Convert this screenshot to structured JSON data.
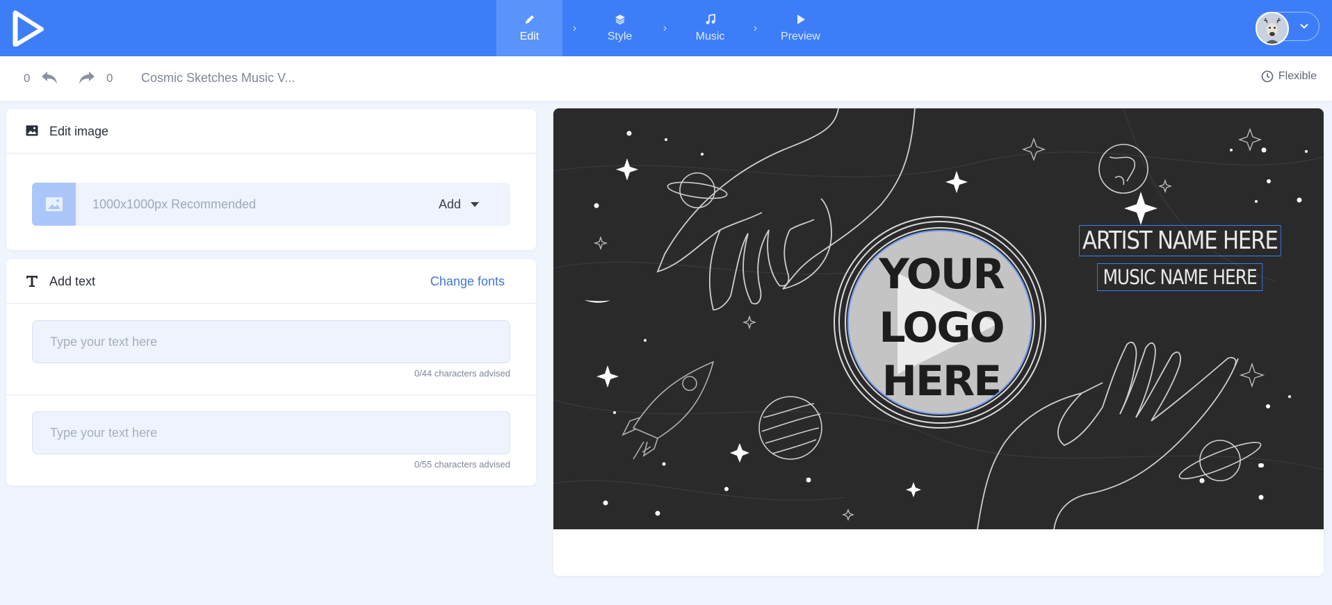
{
  "nav": {
    "steps": [
      {
        "label": "Edit",
        "icon": "pencil-icon",
        "active": true
      },
      {
        "label": "Style",
        "icon": "layers-icon",
        "active": false
      },
      {
        "label": "Music",
        "icon": "music-note-icon",
        "active": false
      },
      {
        "label": "Preview",
        "icon": "play-icon",
        "active": false
      }
    ],
    "separator": "›"
  },
  "toolbar": {
    "undo_count": "0",
    "redo_count": "0",
    "project_title": "Cosmic Sketches Music V...",
    "duration_label": "Flexible"
  },
  "edit_image": {
    "title": "Edit image",
    "placeholder": "1000x1000px Recommended",
    "add_label": "Add"
  },
  "add_text": {
    "title": "Add text",
    "change_fonts": "Change fonts",
    "fields": [
      {
        "placeholder": "Type your text here",
        "hint": "0/44 characters advised"
      },
      {
        "placeholder": "Type your text here",
        "hint": "0/55 characters advised"
      }
    ]
  },
  "canvas": {
    "artist_text": "ARTIST NAME HERE",
    "music_text": "MUSIC NAME HERE",
    "logo_lines": [
      "YOUR",
      "LOGO",
      "HERE"
    ]
  },
  "colors": {
    "brand": "#3d7ef8",
    "canvas_bg": "#2a2a2a",
    "page_bg": "#f0f4fd",
    "link": "#3f77d8"
  }
}
